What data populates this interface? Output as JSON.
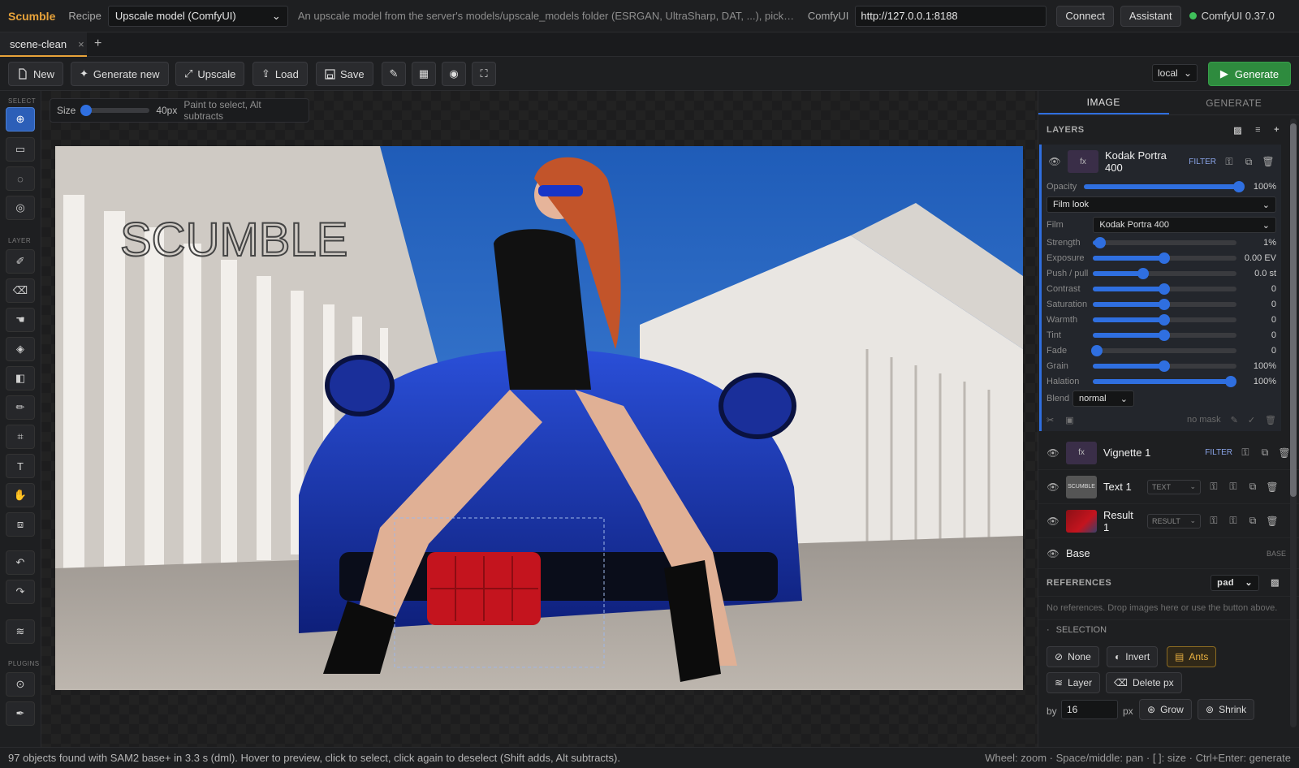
{
  "app": {
    "brand": "Scumble",
    "recipe_label": "Recipe",
    "recipe_value": "Upscale model (ComfyUI)",
    "recipe_desc": "An upscale model from the server's models/upscale_models folder (ESRGAN, UltraSharp, DAT, ...), picked ...",
    "comfy_label": "ComfyUI",
    "comfy_url": "http://127.0.0.1:8188",
    "connect": "Connect",
    "assistant": "Assistant",
    "version": "ComfyUI 0.37.0",
    "status_color": "#3fbf5a"
  },
  "tabs": [
    {
      "label": "scene-clean",
      "close": "×"
    }
  ],
  "tab_add": "+",
  "toolbar": {
    "new": "New",
    "generate_new": "Generate new",
    "upscale": "Upscale",
    "load": "Load",
    "save": "Save",
    "target": "local",
    "generate": "Generate"
  },
  "leftbar": {
    "select_label": "SELECT",
    "layer_label": "LAYER",
    "plugins_label": "PLUGINS"
  },
  "brush": {
    "label": "Size",
    "value_text": "40px",
    "hint": "Paint to select, Alt subtracts",
    "fraction": 0.06
  },
  "canvas": {
    "watermark": "SCUMBLE"
  },
  "panel": {
    "tabs": [
      "IMAGE",
      "GENERATE"
    ],
    "layers_title": "LAYERS",
    "active_layer": {
      "name": "Kodak Portra 400",
      "tag": "FILTER",
      "thumb": "fx",
      "opacity_label": "Opacity",
      "opacity_text": "100%",
      "opacity": 1.0,
      "preset": "Film look",
      "film_label": "Film",
      "film_value": "Kodak Portra 400",
      "params": [
        {
          "label": "Strength",
          "text": "1%",
          "pos": 0.05
        },
        {
          "label": "Exposure",
          "text": "0.00 EV",
          "pos": 0.5
        },
        {
          "label": "Push / pull",
          "text": "0.0 st",
          "pos": 0.35
        },
        {
          "label": "Contrast",
          "text": "0",
          "pos": 0.5
        },
        {
          "label": "Saturation",
          "text": "0",
          "pos": 0.5
        },
        {
          "label": "Warmth",
          "text": "0",
          "pos": 0.5
        },
        {
          "label": "Tint",
          "text": "0",
          "pos": 0.5
        },
        {
          "label": "Fade",
          "text": "0",
          "pos": 0.03
        },
        {
          "label": "Grain",
          "text": "100%",
          "pos": 0.5
        },
        {
          "label": "Halation",
          "text": "100%",
          "pos": 0.96
        }
      ],
      "blend_label": "Blend",
      "blend_value": "normal",
      "mask_text": "no mask"
    },
    "layers": [
      {
        "name": "Vignette 1",
        "tag": "FILTER",
        "thumb": "fx"
      },
      {
        "name": "Text 1",
        "tag": "TEXT",
        "thumb": "SCUMBLE"
      },
      {
        "name": "Result 1",
        "tag": "RESULT",
        "thumb": ""
      }
    ],
    "base": {
      "name": "Base",
      "tag": "BASE"
    },
    "references_title": "REFERENCES",
    "references_mode": "pad",
    "references_empty": "No references. Drop images here or use the button above.",
    "selection_title": "SELECTION",
    "sel_none": "None",
    "sel_invert": "Invert",
    "sel_ants": "Ants",
    "sel_layer": "Layer",
    "sel_delete": "Delete px",
    "by_label": "by",
    "by_value": "16",
    "by_unit": "px",
    "grow": "Grow",
    "shrink": "Shrink"
  },
  "status": {
    "left": "97 objects found with SAM2 base+ in 3.3 s (dml). Hover to preview, click to select, click again to deselect (Shift adds, Alt subtracts).",
    "right": "Wheel: zoom · Space/middle: pan · [ ]: size · Ctrl+Enter: generate"
  }
}
